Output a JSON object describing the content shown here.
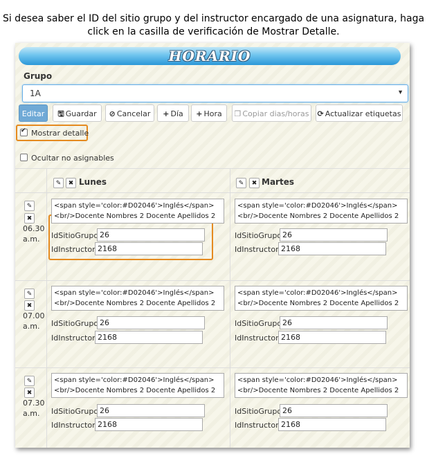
{
  "caption": {
    "line1": "Si desea saber el ID del sitio grupo y del instructor encargado de una asignatura, haga",
    "line2": "click en la casilla de verificación de Mostrar Detalle."
  },
  "banner": {
    "title": "HORARIO"
  },
  "grupo": {
    "label": "Grupo",
    "selected": "1A"
  },
  "toolbar": {
    "edit": "Editar",
    "save": "Guardar",
    "cancel": "Cancelar",
    "day": "Día",
    "hour": "Hora",
    "copy": "Copiar dias/horas",
    "refresh": "Actualizar etiquetas"
  },
  "options": {
    "show_detail": {
      "label": "Mostrar detalle",
      "checked": true
    },
    "hide_unassignable": {
      "label": "Ocultar no asignables",
      "checked": false
    }
  },
  "columns": [
    "Lunes",
    "Martes"
  ],
  "field_labels": {
    "site": "IdSitioGrupo:",
    "instructor": "IdInstructor:"
  },
  "rows": [
    {
      "time1": "06.30",
      "time2": "a.m.",
      "cells": [
        {
          "line1": "<span style='color:#D02046'>Inglés</span>",
          "line2": "<br/>Docente Nombres 2 Docente Apellidos 2",
          "site": "26",
          "instructor": "2168"
        },
        {
          "line1": "<span style='color:#D02046'>Inglés</span>",
          "line2": "<br/>Docente Nombres 2 Docente Apellidos 2",
          "site": "26",
          "instructor": "2168"
        }
      ]
    },
    {
      "time1": "07.00",
      "time2": "a.m.",
      "cells": [
        {
          "line1": "<span style='color:#D02046'>Inglés</span>",
          "line2": "<br/>Docente Nombres 2 Docente Apellidos 2",
          "site": "26",
          "instructor": "2168"
        },
        {
          "line1": "<span style='color:#D02046'>Inglés</span>",
          "line2": "<br/>Docente Nombres 2 Docente Apellidos 2",
          "site": "26",
          "instructor": "2168"
        }
      ]
    },
    {
      "time1": "07.30",
      "time2": "a.m.",
      "cells": [
        {
          "line1": "<span style='color:#D02046'>Inglés</span>",
          "line2": "<br/>Docente Nombres 2 Docente Apellidos 2",
          "site": "26",
          "instructor": "2168"
        },
        {
          "line1": "<span style='color:#D02046'>Inglés</span>",
          "line2": "<br/>Docente Nombres 2 Docente Apellidos 2",
          "site": "26",
          "instructor": "2168"
        }
      ]
    }
  ],
  "colors": {
    "highlight": "#e58a1f",
    "primary_button": "#6fa9d6",
    "banner": "#2b97d8"
  }
}
